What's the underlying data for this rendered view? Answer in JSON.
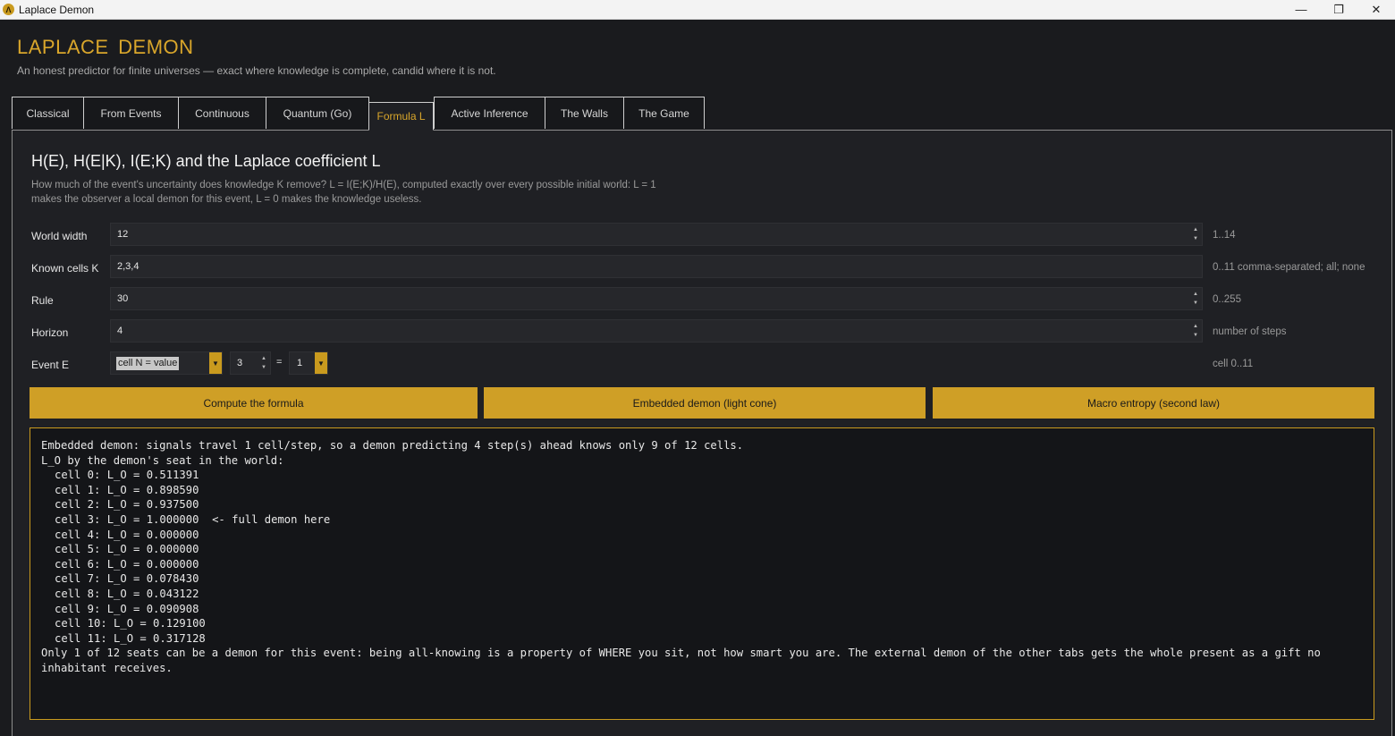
{
  "window": {
    "icon": "Λ",
    "title": "Laplace Demon",
    "controls": {
      "minimize": "—",
      "restore": "❐",
      "close": "✕"
    }
  },
  "header": {
    "title": "LAPLACE  DEMON",
    "subtitle": "An honest predictor for finite universes — exact where knowledge is complete, candid where it is not."
  },
  "tabs": [
    {
      "label": "Classical"
    },
    {
      "label": "From Events"
    },
    {
      "label": "Continuous"
    },
    {
      "label": "Quantum (Go)"
    },
    {
      "label": "Formula L"
    },
    {
      "label": "Active Inference"
    },
    {
      "label": "The Walls"
    },
    {
      "label": "The Game"
    }
  ],
  "active_tab": "Formula L",
  "panel": {
    "title": "H(E), H(E|K), I(E;K) and the Laplace coefficient L",
    "description": "How much of the event's uncertainty does knowledge K remove? L = I(E;K)/H(E), computed exactly over every possible initial world: L = 1 makes the observer a local demon for this event, L = 0 makes the knowledge useless."
  },
  "form": {
    "world_width": {
      "label": "World width",
      "value": "12",
      "hint": "1..14"
    },
    "known_cells": {
      "label": "Known cells K",
      "value": "2,3,4",
      "hint": "0..11 comma-separated; all; none"
    },
    "rule": {
      "label": "Rule",
      "value": "30",
      "hint": "0..255"
    },
    "horizon": {
      "label": "Horizon",
      "value": "4",
      "hint": "number of steps"
    },
    "event": {
      "label": "Event E",
      "type_selected": "cell N = value",
      "cell": "3",
      "equals": "=",
      "value": "1",
      "hint": "cell 0..11"
    }
  },
  "buttons": {
    "compute": "Compute the formula",
    "embedded": "Embedded demon (light cone)",
    "macro": "Macro entropy (second law)"
  },
  "output": {
    "intro": "Embedded demon: signals travel 1 cell/step, so a demon predicting 4 step(s) ahead knows only 9 of 12 cells.",
    "heading": "L_O by the demon's seat in the world:",
    "cells": [
      "cell 0: L_O = 0.511391",
      "cell 1: L_O = 0.898590",
      "cell 2: L_O = 0.937500",
      "cell 3: L_O = 1.000000  <- full demon here",
      "cell 4: L_O = 0.000000",
      "cell 5: L_O = 0.000000",
      "cell 6: L_O = 0.000000",
      "cell 7: L_O = 0.078430",
      "cell 8: L_O = 0.043122",
      "cell 9: L_O = 0.090908",
      "cell 10: L_O = 0.129100",
      "cell 11: L_O = 0.317128"
    ],
    "conclusion": "Only 1 of 12 seats can be a demon for this event: being all-knowing is a property of WHERE you sit, not how smart you are. The external demon of the other tabs gets the whole present as a gift no inhabitant receives."
  },
  "colors": {
    "accent": "#cf9f26",
    "title_gold": "#d9a62b",
    "background": "#1a1b1e",
    "panel": "#1f2024"
  }
}
